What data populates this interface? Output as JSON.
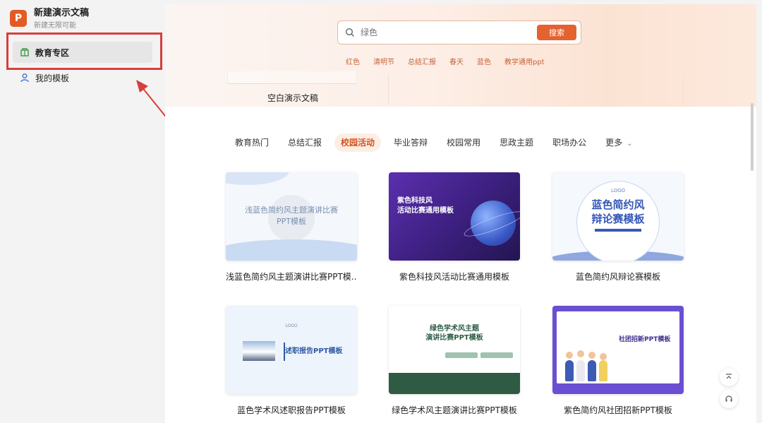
{
  "app": {
    "logo_letter": "P",
    "title": "新建演示文稿",
    "subtitle": "新建无限可能"
  },
  "sidebar": {
    "items": [
      {
        "label": "教育专区",
        "icon": "education-icon",
        "active": true
      },
      {
        "label": "我的模板",
        "icon": "user-icon",
        "active": false
      }
    ]
  },
  "search": {
    "placeholder": "绿色",
    "button_label": "搜索",
    "hot_tags": [
      "红色",
      "清明节",
      "总结汇报",
      "春天",
      "蓝色",
      "教学通用ppt"
    ]
  },
  "blank_doc": {
    "label": "空白演示文稿"
  },
  "categories": [
    {
      "label": "教育热门",
      "active": false
    },
    {
      "label": "总结汇报",
      "active": false
    },
    {
      "label": "校园活动",
      "active": true
    },
    {
      "label": "毕业答辩",
      "active": false
    },
    {
      "label": "校园常用",
      "active": false
    },
    {
      "label": "思政主题",
      "active": false
    },
    {
      "label": "职场办公",
      "active": false
    },
    {
      "label": "更多",
      "active": false
    }
  ],
  "templates": [
    {
      "title": "浅蓝色简约风主题演讲比赛PPT模...",
      "thumb_text": "浅蓝色简约风主题演讲比赛\nPPT模板"
    },
    {
      "title": "紫色科技风活动比赛通用模板",
      "thumb_text": "紫色科技风\n活动比赛通用模板"
    },
    {
      "title": "蓝色简约风辩论赛模板",
      "thumb_logo": "LOGO",
      "thumb_text": "蓝色简约风\n辩论赛模板"
    },
    {
      "title": "蓝色学术风述职报告PPT模板",
      "thumb_logo": "LOGO",
      "thumb_text": "述职报告PPT模板"
    },
    {
      "title": "绿色学术风主题演讲比赛PPT模板",
      "thumb_text": "绿色学术风主题\n演讲比赛PPT模板"
    },
    {
      "title": "紫色简约风社团招新PPT模板",
      "thumb_text": "社团招新PPT模板"
    }
  ],
  "colors": {
    "accent": "#e3622f",
    "highlight": "#d6403b",
    "active_tab_text": "#d3541f"
  }
}
